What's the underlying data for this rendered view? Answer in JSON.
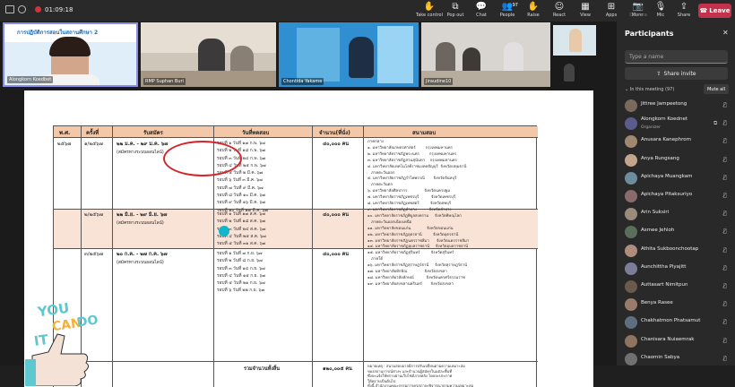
{
  "top_bar": {
    "timer": "01:09:18",
    "buttons": [
      {
        "label": "Take control",
        "glyph": "✋",
        "dim": false
      },
      {
        "label": "Pop out",
        "glyph": "⧉",
        "dim": false
      },
      {
        "label": "Chat",
        "glyph": "💬",
        "dim": false
      },
      {
        "label": "People",
        "glyph": "👥",
        "dim": false
      },
      {
        "label": "Raise",
        "glyph": "✋",
        "dim": false
      },
      {
        "label": "React",
        "glyph": "☺",
        "dim": false
      },
      {
        "label": "View",
        "glyph": "▦",
        "dim": false
      },
      {
        "label": "Apps",
        "glyph": "⊞",
        "dim": false
      },
      {
        "label": "More",
        "glyph": "⋯",
        "dim": false
      },
      {
        "label": "Camera",
        "glyph": "📷",
        "dim": true
      },
      {
        "label": "Mic",
        "glyph": "🎙",
        "dim": false
      },
      {
        "label": "Share",
        "glyph": "⇪",
        "dim": false
      }
    ],
    "people_count": "97",
    "leave_label": "Leave"
  },
  "video_tiles": [
    {
      "name": "Alongkorn Koedbet",
      "kind": "slide",
      "slide_text": "การปฏิบัติการสอนในสถานศึกษา 2"
    },
    {
      "name": "RMP Suphan Buri",
      "kind": "room"
    },
    {
      "name": "Chontida Yakame",
      "kind": "banner"
    },
    {
      "name": "Jiraudine10",
      "kind": "room"
    },
    {
      "name": "",
      "kind": "person"
    }
  ],
  "shared_doc": {
    "headers": [
      "พ.ศ.",
      "ครั้งที่",
      "รับสมัคร",
      "วันที่ทดสอบ",
      "จำนวน(ที่นั่ง)",
      "สนามสอบ"
    ],
    "rows": [
      {
        "year": "๒๕๖๗",
        "round": "๑/๒๕๖๗",
        "apply": "๒๒ ม.ค. - ๒๙ ม.ค. ๖๗",
        "apply_note": "(สมัครทางระบบออนไลน์)",
        "dates": "รอบที่ ๑ วันที่ ๑๗ ก.พ. ๖๗\nรอบที่ ๒ วันที่ ๑๘ ก.พ. ๖๗\nรอบที่ ๓ วันที่ ๒๔ ก.พ. ๖๗\nรอบที่ ๔ วันที่ ๒๕ ก.พ. ๖๗\nรอบที่ ๕ วันที่ ๒ มี.ค. ๖๗\nรอบที่ ๖ วันที่ ๓ มี.ค. ๖๗\nรอบที่ ๗ วันที่ ๙ มี.ค. ๖๗\nรอบที่ ๘ วันที่ ๑๐ มี.ค. ๖๗\nรอบที่ ๙ วันที่ ๑๖ มี.ค. ๖๗\nรอบที่ ๑๐ วันที่ ๑๗ มี.ค. ๖๗",
        "seats": "๔๐,๐๐๐ คน"
      },
      {
        "year": "",
        "round": "๒/๒๕๖๗",
        "apply": "๒๒ มิ.ย. - ๒๙ มิ.ย. ๖๗",
        "apply_note": "(สมัครทางระบบออนไลน์)",
        "dates": "รอบที่ ๑ วันที่ ๑๗ ส.ค. ๖๗\nรอบที่ ๒ วันที่ ๑๘ ส.ค. ๖๗\nรอบที่ ๓ วันที่ ๒๔ ส.ค. ๖๗\nรอบที่ ๔ วันที่ ๒๕ ส.ค. ๖๗\nรอบที่ ๕ วันที่ ๓๑ ส.ค. ๖๗",
        "seats": "๔๐,๐๐๐ คน"
      },
      {
        "year": "",
        "round": "๓/๒๕๖๗",
        "apply": "๒๐ ก.ค. - ๒๗ ก.ค. ๖๗",
        "apply_note": "(สมัครทางระบบออนไลน์)",
        "dates": "รอบที่ ๑ วันที่ ๗ ก.ย. ๖๗\nรอบที่ ๒ วันที่ ๘ ก.ย. ๖๗\nรอบที่ ๓ วันที่ ๑๔ ก.ย. ๖๗\nรอบที่ ๔ วันที่ ๑๕ ก.ย. ๖๗\nรอบที่ ๕ วันที่ ๒๑ ก.ย. ๖๗\nรอบที่ ๖ วันที่ ๒๒ ก.ย. ๖๗",
        "seats": "๔๐,๐๐๐ คน"
      }
    ],
    "venues": "ภาคกลาง\n๑. มหาวิทยาลัยเกษตรศาสตร์        กรุงเทพมหานคร\n๒. มหาวิทยาลัยราชภัฏพระนคร        กรุงเทพมหานคร\n๓. มหาวิทยาลัยราชภัฏสวนสุนันทา    กรุงเทพมหานคร\n๔. มหาวิทยาลัยเทคโนโลยีราชมงคลธัญบุรี  จังหวัดปทุมธานี\n   ภาคตะวันออก\n๕. มหาวิทยาลัยราชภัฏรำไพพรรณี       จังหวัดจันทบุรี\n   ภาคตะวันตก\n๖. มหาวิทยาลัยศิลปากร              จังหวัดนครปฐม\n๗. มหาวิทยาลัยราชภัฏเพชรบุรี          จังหวัดเพชรบุรี\n๘. มหาวิทยาลัยราชภัฏเทพสตรี         จังหวัดลพบุรี\n๙. มหาวิทยาลัยราชภัฏลำปาง          จังหวัดลำปาง\n๑๐. มหาวิทยาลัยราชภัฏพิบูลสงคราม     จังหวัดพิษณุโลก\n   ภาคตะวันออกเฉียงเหนือ\n๑๑. มหาวิทยาลัยขอนแก่น             จังหวัดขอนแก่น\n๑๒. มหาวิทยาลัยราชภัฏอุดรธานี         จังหวัดอุดรธานี\n๑๓. มหาวิทยาลัยราชภัฏนครราชสีมา      จังหวัดนครราชสีมา\n๑๔. มหาวิทยาลัยราชภัฏอุบลราชธานี     จังหวัดอุบลราชธานี\n๑๕. มหาวิทยาลัยราชภัฏสุรินทร์         จังหวัดสุรินทร์\n   ภาคใต้\n๑๖. มหาวิทยาลัยราชภัฏสุราษฎร์ธานี     จังหวัดสุราษฎร์ธานี\n๑๗. มหาวิทยาลัยทักษิณ              จังหวัดสงขลา\n๑๘. มหาวิทยาลัยวลัยลักษณ์          จังหวัดนครศรีธรรมราช\n๑๙. มหาวิทยาลัยสงขลานครินทร์       จังหวัดสงขลา",
    "total_label": "รวมจำนวนทั้งสิ้น",
    "total_value": "๑๒๐,๐๐๕ คน",
    "remark": "หมายเหตุ : สนามสอบอาจมีการปรับเปลี่ยนตามความเหมาะสม\nของสถานการณ์ต่างๆ และจำนวนผู้สมัครในแต่ละพื้นที่\nซึ่งจะแจ้งให้ทราบผ่านเว็บไซต์ภายหลัง โดยจะประกาศ\nให้ทราบเป็นต้นไป\nทั้งนี้ สำนักงานคณะกรรมการคุรุสภาจะพิจารณาตามความเหมาะสม\nสำหรับการทดสอบแต่ละครั้ง",
    "sticker_text": [
      "YOU",
      "CAN",
      "DO",
      "IT"
    ]
  },
  "participants": {
    "title": "Participants",
    "search_placeholder": "Type a name",
    "share_invite": "Share invite",
    "in_meeting": "In this meeting (97)",
    "mute_all": "Mute all",
    "people": [
      {
        "name": "Jittree Jampeetong",
        "role": ""
      },
      {
        "name": "Alongkorn Koednet",
        "role": "Organizer"
      },
      {
        "name": "Anusara Kanephrom",
        "role": ""
      },
      {
        "name": "Anya Rungsang",
        "role": ""
      },
      {
        "name": "Apichaya Muangkam",
        "role": ""
      },
      {
        "name": "Apichaya Pitaksuriyo",
        "role": ""
      },
      {
        "name": "Arin Suksiri",
        "role": ""
      },
      {
        "name": "Asmee Jehloh",
        "role": ""
      },
      {
        "name": "Athita Sukboonchootap",
        "role": ""
      },
      {
        "name": "Aunchittha Piyajitt",
        "role": ""
      },
      {
        "name": "Auttasart Nimitpun",
        "role": ""
      },
      {
        "name": "Benya Rasee",
        "role": ""
      },
      {
        "name": "Chakhatmon Phatsamut",
        "role": ""
      },
      {
        "name": "Chanisara Nuiaemrak",
        "role": ""
      },
      {
        "name": "Chaomin Sabya",
        "role": ""
      }
    ]
  }
}
